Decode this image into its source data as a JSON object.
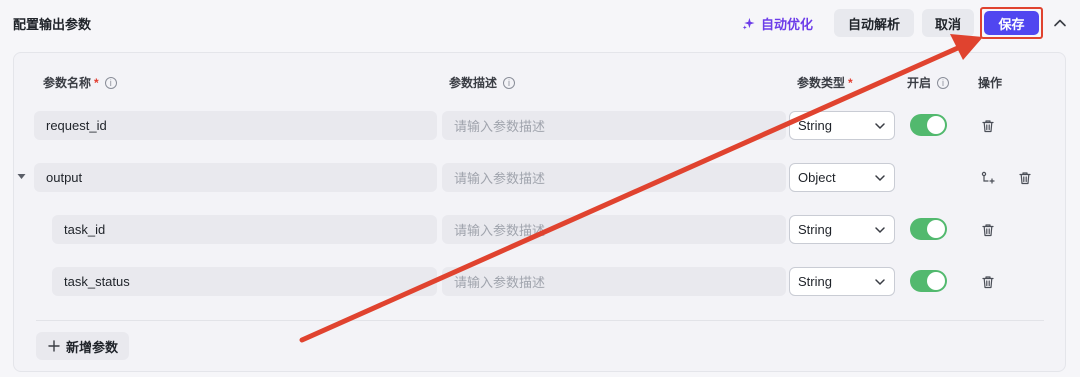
{
  "header": {
    "title": "配置输出参数",
    "auto_optimize_label": "自动优化",
    "auto_parse_label": "自动解析",
    "cancel_label": "取消",
    "save_label": "保存"
  },
  "table": {
    "columns": {
      "name": "参数名称",
      "description": "参数描述",
      "type": "参数类型",
      "enabled": "开启",
      "actions": "操作"
    },
    "rows": [
      {
        "name": "request_id",
        "description_placeholder": "请输入参数描述",
        "type": "String",
        "enabled": true,
        "level": 0
      },
      {
        "name": "output",
        "description_placeholder": "请输入参数描述",
        "type": "Object",
        "expandable": true,
        "level": 0
      },
      {
        "name": "task_id",
        "description_placeholder": "请输入参数描述",
        "type": "String",
        "enabled": true,
        "level": 1
      },
      {
        "name": "task_status",
        "description_placeholder": "请输入参数描述",
        "type": "String",
        "enabled": true,
        "level": 1
      }
    ]
  },
  "footer": {
    "add_param_label": "新增参数"
  },
  "colors": {
    "accent": "#5046f0",
    "auto_optimize": "#6c3ce9",
    "toggle_on": "#52b96e",
    "annotation_red": "#e0432f"
  },
  "icons": [
    "sparkle-icon",
    "chevron-up-icon",
    "info-icon",
    "chevron-down-icon",
    "trash-icon",
    "add-child-icon",
    "caret-down-icon",
    "plus-icon"
  ]
}
